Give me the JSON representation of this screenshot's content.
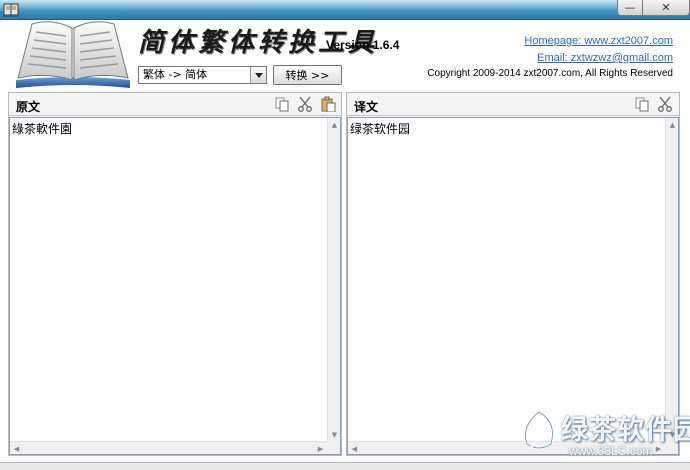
{
  "window": {
    "minimize_glyph": "—",
    "close_glyph": "✕"
  },
  "header": {
    "title": "简体繁体转换工具",
    "version": "Version 1.6.4",
    "homepage": "Homepage: www.zxt2007.com",
    "email": "Email: zxtwzwz@gmail.com",
    "copyright": "Copyright 2009-2014 zxt2007.com, All Rights Reserved"
  },
  "toolbar": {
    "mode_selected": "繁体 -> 简体",
    "convert_label": "转换 >>"
  },
  "left_panel": {
    "title": "原文",
    "content": "綠茶軟件園",
    "icons": [
      "copy-icon",
      "cut-icon",
      "paste-icon"
    ]
  },
  "right_panel": {
    "title": "译文",
    "content": "绿茶软件园",
    "icons": [
      "copy-icon",
      "cut-icon"
    ]
  },
  "watermark": {
    "text": "绿茶软件园",
    "url": "www.33LC.com"
  },
  "colors": {
    "title_bar": "#3f8eb8",
    "link": "#2a6ac7",
    "panel_bg": "#f4f4f4"
  }
}
